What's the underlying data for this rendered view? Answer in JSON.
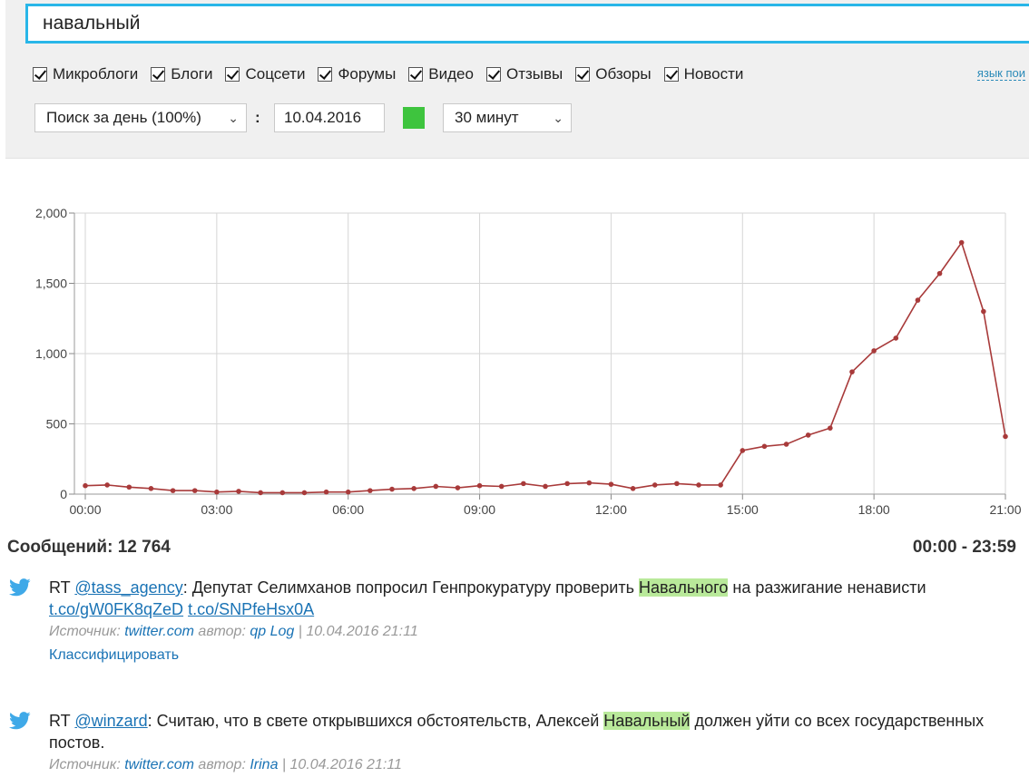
{
  "search": {
    "value": "навальный"
  },
  "filters": [
    {
      "label": "Микроблоги",
      "checked": true
    },
    {
      "label": "Блоги",
      "checked": true
    },
    {
      "label": "Соцсети",
      "checked": true
    },
    {
      "label": "Форумы",
      "checked": true
    },
    {
      "label": "Видео",
      "checked": true
    },
    {
      "label": "Отзывы",
      "checked": true
    },
    {
      "label": "Обзоры",
      "checked": true
    },
    {
      "label": "Новости",
      "checked": true
    }
  ],
  "lang_link": "язык пои",
  "controls": {
    "period_select": "Поиск за день (100%)",
    "separator": ":",
    "date": "10.04.2016",
    "interval_select": "30 минут",
    "status_color": "#3ec43e"
  },
  "chart_data": {
    "type": "line",
    "x_labels": [
      "00:00",
      "03:00",
      "06:00",
      "09:00",
      "12:00",
      "15:00",
      "18:00",
      "21:00"
    ],
    "x": [
      "00:00",
      "00:30",
      "01:00",
      "01:30",
      "02:00",
      "02:30",
      "03:00",
      "03:30",
      "04:00",
      "04:30",
      "05:00",
      "05:30",
      "06:00",
      "06:30",
      "07:00",
      "07:30",
      "08:00",
      "08:30",
      "09:00",
      "09:30",
      "10:00",
      "10:30",
      "11:00",
      "11:30",
      "12:00",
      "12:30",
      "13:00",
      "13:30",
      "14:00",
      "14:30",
      "15:00",
      "15:30",
      "16:00",
      "16:30",
      "17:00",
      "17:30",
      "18:00",
      "18:30",
      "19:00",
      "19:30",
      "20:00",
      "20:30",
      "21:00"
    ],
    "values": [
      60,
      65,
      50,
      40,
      25,
      25,
      15,
      20,
      10,
      10,
      10,
      15,
      15,
      25,
      35,
      40,
      55,
      45,
      60,
      55,
      75,
      55,
      75,
      80,
      70,
      40,
      65,
      75,
      65,
      65,
      310,
      340,
      355,
      420,
      470,
      870,
      1020,
      1110,
      1380,
      1570,
      1790,
      1300,
      410
    ],
    "y_ticks": [
      "0",
      "500",
      "1,000",
      "1,500",
      "2,000"
    ],
    "ylim": [
      0,
      2000
    ],
    "line_color": "#a83a3a",
    "grid": true
  },
  "summary": {
    "label": "Сообщений: 12 764",
    "range": "00:00 - 23:59"
  },
  "posts": [
    {
      "prefix": "RT ",
      "mention": "@tass_agency",
      "text_before": ": Депутат Селимханов попросил Генпрокуратуру проверить ",
      "highlight": "Навального",
      "text_after": " на разжигание ненависти",
      "link1": "t.co/gW0FK8qZeD",
      "link2": "t.co/SNPfeHsx0A",
      "source_label": "Источник:",
      "source": "twitter.com",
      "author_label": "автор:",
      "author": "qp Log",
      "sep": "|",
      "datetime": "10.04.2016 21:11",
      "classify": "Классифицировать"
    },
    {
      "prefix": "RT ",
      "mention": "@winzard",
      "text_before": ": Считаю, что в свете открывшихся обстоятельств, Алексей ",
      "highlight": "Навальный",
      "text_after": " должен уйти со всех государственных постов.",
      "source_label": "Источник:",
      "source": "twitter.com",
      "author_label": "автор:",
      "author": "Irina",
      "sep": "|",
      "datetime": "10.04.2016 21:11"
    }
  ]
}
